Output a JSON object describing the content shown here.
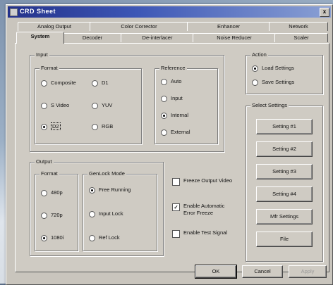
{
  "window": {
    "title": "CRD Sheet",
    "close_glyph": "x"
  },
  "tabs_back": [
    "Analog Output",
    "Color Corrector",
    "Enhancer",
    "Network"
  ],
  "tabs_front": [
    "System",
    "Decoder",
    "De-interlacer",
    "Noise Reducer",
    "Scaler"
  ],
  "input": {
    "label": "Input",
    "format": {
      "label": "Format",
      "options": [
        "Composite",
        "D1",
        "S Video",
        "YUV",
        "D2",
        "RGB"
      ],
      "selected": "D2"
    },
    "reference": {
      "label": "Reference",
      "options": [
        "Auto",
        "Input",
        "Internal",
        "External"
      ],
      "selected": "Internal"
    }
  },
  "output": {
    "label": "Output",
    "format": {
      "label": "Format",
      "options": [
        "480p",
        "720p",
        "1080i"
      ],
      "selected": "1080i"
    },
    "genlock": {
      "label": "GenLock Mode",
      "options": [
        "Free Running",
        "Input Lock",
        "Ref Lock"
      ],
      "selected": "Free Running"
    }
  },
  "checks": [
    {
      "label": "Freeze Output Video",
      "checked": false
    },
    {
      "label": "Enable Automatic Error Freeze",
      "checked": true
    },
    {
      "label": "Enable Test Signal",
      "checked": false
    }
  ],
  "action": {
    "label": "Action",
    "options": [
      "Load Settings",
      "Save Settings"
    ],
    "selected": "Load Settings"
  },
  "select_settings": {
    "label": "Select Settings",
    "buttons": [
      "Setting #1",
      "Setting #2",
      "Setting #3",
      "Setting #4",
      "Mfr Settings",
      "File"
    ]
  },
  "footer": {
    "ok": "OK",
    "cancel": "Cancel",
    "apply": "Apply"
  }
}
